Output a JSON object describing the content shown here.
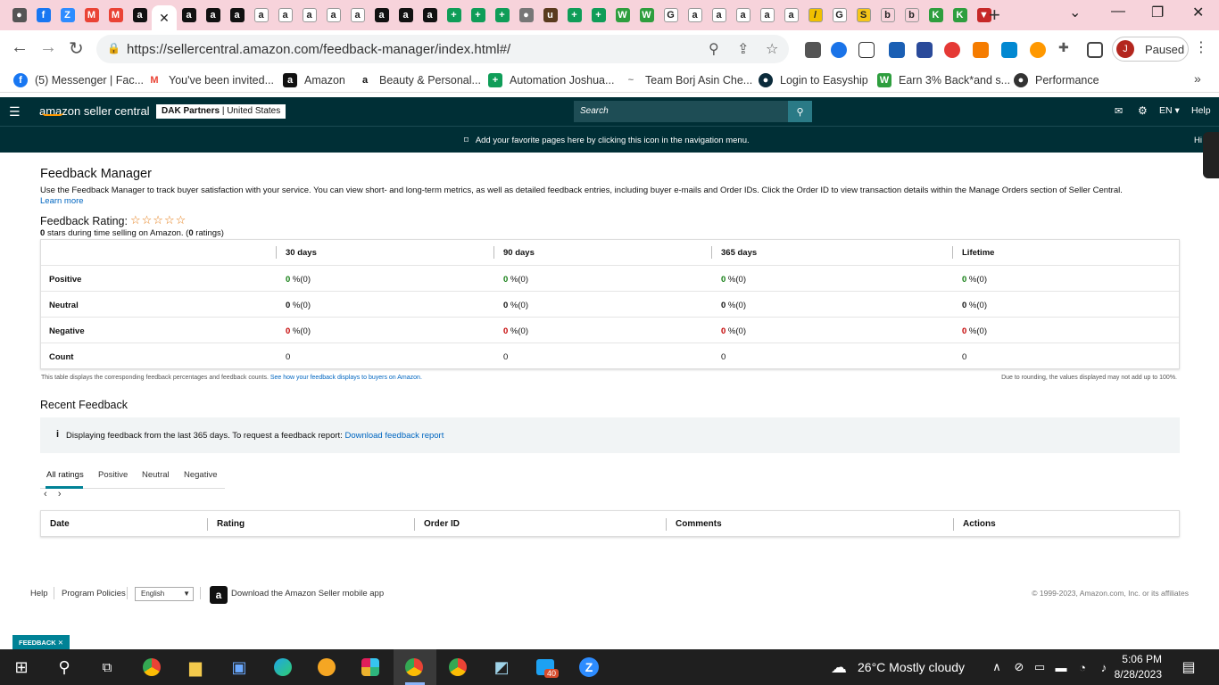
{
  "browser": {
    "address": "https://sellercentral.amazon.com/feedback-manager/index.html#/",
    "profile_label": "Paused",
    "profile_initial": "J",
    "tabs": [
      {
        "icon": "github",
        "color": "#555",
        "glyph": "●"
      },
      {
        "icon": "facebook",
        "color": "#1877f2",
        "glyph": "f"
      },
      {
        "icon": "zoom",
        "color": "#2d8cff",
        "glyph": "Z"
      },
      {
        "icon": "gmail",
        "color": "#ea4335",
        "glyph": "M"
      },
      {
        "icon": "gmail",
        "color": "#ea4335",
        "glyph": "M"
      },
      {
        "icon": "amazon",
        "color": "#111",
        "glyph": "a"
      },
      {
        "icon": "amazon",
        "color": "#111",
        "glyph": "a"
      },
      {
        "icon": "amazon",
        "color": "#111",
        "glyph": "a"
      },
      {
        "icon": "amazon",
        "color": "#111",
        "glyph": "a"
      },
      {
        "icon": "amazon-smile",
        "color": "#fff",
        "glyph": "a"
      },
      {
        "icon": "amazon-smile",
        "color": "#fff",
        "glyph": "a"
      },
      {
        "icon": "amazon-smile",
        "color": "#fff",
        "glyph": "a"
      },
      {
        "icon": "amazon-smile",
        "color": "#fff",
        "glyph": "a"
      },
      {
        "icon": "amazon-smile",
        "color": "#fff",
        "glyph": "a"
      },
      {
        "icon": "amazon",
        "color": "#111",
        "glyph": "a"
      },
      {
        "icon": "amazon",
        "color": "#111",
        "glyph": "a"
      },
      {
        "icon": "amazon",
        "color": "#111",
        "glyph": "a"
      },
      {
        "icon": "sheets",
        "color": "#0f9d58",
        "glyph": "+"
      },
      {
        "icon": "sheets",
        "color": "#0f9d58",
        "glyph": "+"
      },
      {
        "icon": "sheets",
        "color": "#0f9d58",
        "glyph": "+"
      },
      {
        "icon": "globe",
        "color": "#777",
        "glyph": "●"
      },
      {
        "icon": "ups",
        "color": "#5a3a1e",
        "glyph": "u"
      },
      {
        "icon": "sheets",
        "color": "#0f9d58",
        "glyph": "+"
      },
      {
        "icon": "sheets",
        "color": "#0f9d58",
        "glyph": "+"
      },
      {
        "icon": "w-green",
        "color": "#2e9e3e",
        "glyph": "W"
      },
      {
        "icon": "w-green",
        "color": "#2e9e3e",
        "glyph": "W"
      },
      {
        "icon": "google",
        "color": "#fff",
        "glyph": "G"
      },
      {
        "icon": "amazon-smile",
        "color": "#fff",
        "glyph": "a"
      },
      {
        "icon": "amazon-smile",
        "color": "#fff",
        "glyph": "a"
      },
      {
        "icon": "amazon-smile",
        "color": "#fff",
        "glyph": "a"
      },
      {
        "icon": "amazon-smile",
        "color": "#fff",
        "glyph": "a"
      },
      {
        "icon": "amazon-smile",
        "color": "#fff",
        "glyph": "a"
      },
      {
        "icon": "pen",
        "color": "#f0c000",
        "glyph": "/"
      },
      {
        "icon": "google",
        "color": "#fff",
        "glyph": "G"
      },
      {
        "icon": "s-yellow",
        "color": "#f5c518",
        "glyph": "S"
      },
      {
        "icon": "b-outline",
        "color": "#f7d3db",
        "glyph": "b"
      },
      {
        "icon": "b-outline",
        "color": "#f7d3db",
        "glyph": "b"
      },
      {
        "icon": "k-green",
        "color": "#2e9e3e",
        "glyph": "K"
      },
      {
        "icon": "k-green",
        "color": "#2e9e3e",
        "glyph": "K"
      },
      {
        "icon": "v-red",
        "color": "#c62828",
        "glyph": "▼"
      }
    ],
    "bookmarks": [
      {
        "label": "(5) Messenger | Fac...",
        "icon": "facebook",
        "color": "#1877f2",
        "glyph": "f"
      },
      {
        "label": "You've been invited...",
        "icon": "gmail",
        "color": "#fff",
        "glyph": "M"
      },
      {
        "label": "Amazon",
        "icon": "amazon",
        "color": "#111",
        "glyph": "a"
      },
      {
        "label": "Beauty & Personal...",
        "icon": "amazon-smile",
        "color": "#fff",
        "glyph": "a"
      },
      {
        "label": "Automation Joshua...",
        "icon": "sheets",
        "color": "#0f9d58",
        "glyph": "+"
      },
      {
        "label": "Team Borj Asin Che...",
        "icon": "team",
        "color": "#fff",
        "glyph": "~"
      },
      {
        "label": "Login to Easyship",
        "icon": "easyship",
        "color": "#0b2b3b",
        "glyph": "●"
      },
      {
        "label": "Earn 3% Back*and s...",
        "icon": "w-green",
        "color": "#2e9e3e",
        "glyph": "W"
      },
      {
        "label": "Performance",
        "icon": "globe",
        "color": "#333",
        "glyph": "●"
      }
    ]
  },
  "seller_central": {
    "brand": "amazon seller central",
    "account_name": "DAK Partners",
    "marketplace": "United States",
    "search_placeholder": "Search",
    "language": "EN",
    "help": "Help",
    "favorites_hint": "Add your favorite pages here by clicking this icon in the navigation menu.",
    "favorites_hint_right": "Hi"
  },
  "feedback_manager": {
    "title": "Feedback Manager",
    "intro": "Use the Feedback Manager to track buyer satisfaction with your service. You can view short- and long-term metrics, as well as detailed feedback entries, including buyer e-mails and Order IDs. Click the Order ID to view transaction details within the Manage Orders section of Seller Central.",
    "learn_more": "Learn more",
    "rating_heading": "Feedback Rating:",
    "stars": "☆☆☆☆☆",
    "rating_stars_value": "0",
    "rating_text_1": "stars during time selling on Amazon. (",
    "rating_count": "0",
    "rating_text_2": "ratings)",
    "table": {
      "columns": [
        "30 days",
        "90 days",
        "365 days",
        "Lifetime"
      ],
      "rows": [
        {
          "label": "Positive",
          "kind": "pos",
          "values": [
            {
              "n": "0",
              "p": " %(0)"
            },
            {
              "n": "0",
              "p": " %(0)"
            },
            {
              "n": "0",
              "p": " %(0)"
            },
            {
              "n": "0",
              "p": " %(0)"
            }
          ]
        },
        {
          "label": "Neutral",
          "kind": "neu",
          "values": [
            {
              "n": "0",
              "p": " %(0)"
            },
            {
              "n": "0",
              "p": " %(0)"
            },
            {
              "n": "0",
              "p": " %(0)"
            },
            {
              "n": "0",
              "p": " %(0)"
            }
          ]
        },
        {
          "label": "Negative",
          "kind": "neg",
          "values": [
            {
              "n": "0",
              "p": " %(0)"
            },
            {
              "n": "0",
              "p": " %(0)"
            },
            {
              "n": "0",
              "p": " %(0)"
            },
            {
              "n": "0",
              "p": " %(0)"
            }
          ]
        },
        {
          "label": "Count",
          "kind": "count",
          "values": [
            {
              "n": "0",
              "p": ""
            },
            {
              "n": "0",
              "p": ""
            },
            {
              "n": "0",
              "p": ""
            },
            {
              "n": "0",
              "p": ""
            }
          ]
        }
      ]
    },
    "table_note_left_1": "This table displays the corresponding feedback percentages and feedback counts.",
    "table_note_link": "See how your feedback displays to buyers on Amazon.",
    "table_note_right": "Due to rounding, the values displayed may not add up to 100%.",
    "recent_heading": "Recent Feedback",
    "info_text": "Displaying feedback from the last 365 days. To request a feedback report:",
    "info_link": "Download feedback report",
    "tabs": [
      "All ratings",
      "Positive",
      "Neutral",
      "Negative"
    ],
    "pager_prev": "‹",
    "pager_next": "›",
    "list_columns": [
      "Date",
      "Rating",
      "Order ID",
      "Comments",
      "Actions"
    ]
  },
  "page_footer": {
    "help": "Help",
    "program_policies": "Program Policies",
    "language": "English",
    "app_text": "Download the Amazon Seller mobile app",
    "copyright": "© 1999-2023, Amazon.com, Inc. or its affiliates",
    "feedback_tag": "FEEDBACK"
  },
  "taskbar": {
    "weather": "26°C  Mostly cloudy",
    "time": "5:06 PM",
    "date": "8/28/2023",
    "badge": "40"
  }
}
